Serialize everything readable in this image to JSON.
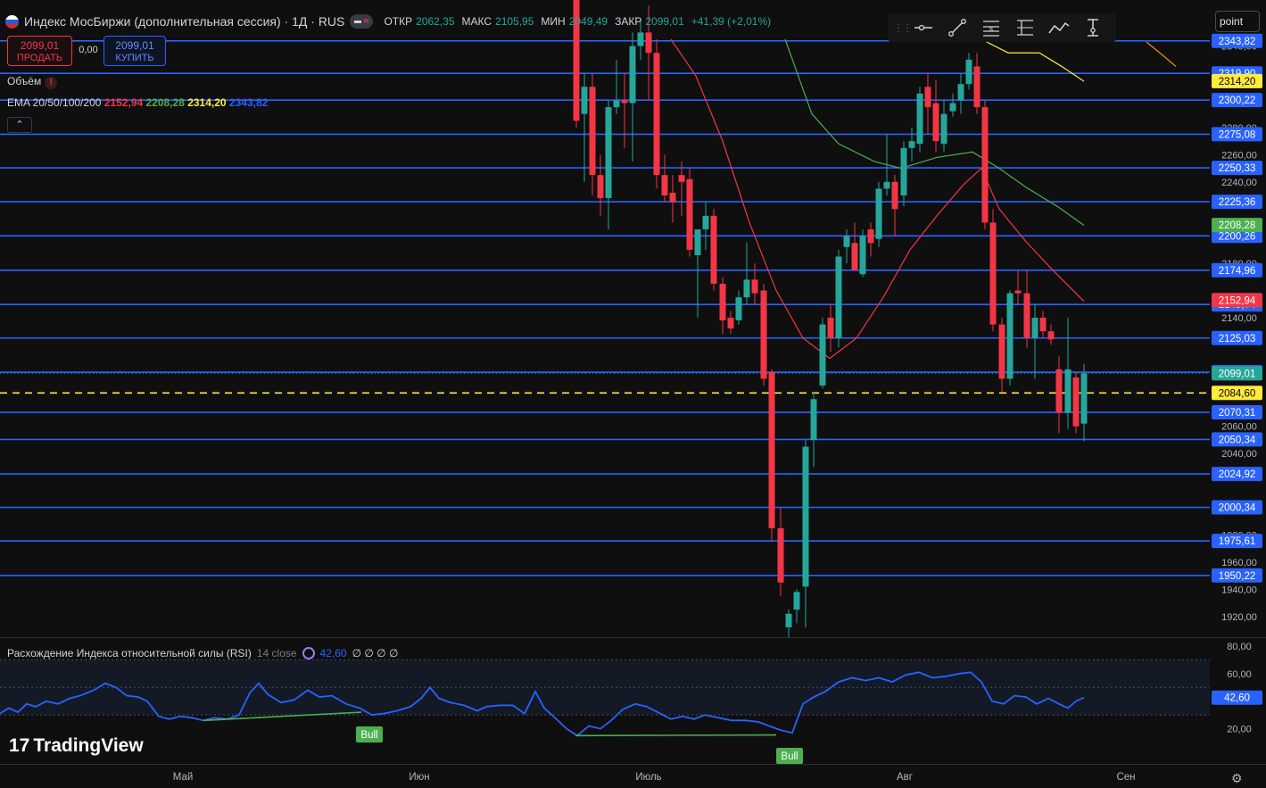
{
  "header": {
    "title": "Индекс МосБиржи (дополнительная сессия) · 1Д · RUS",
    "ohlc": [
      {
        "label": "ОТКР",
        "value": "2062,35"
      },
      {
        "label": "МАКС",
        "value": "2105,95"
      },
      {
        "label": "МИН",
        "value": "2049,49"
      },
      {
        "label": "ЗАКР",
        "value": "2099,01"
      },
      {
        "label": "",
        "value": "+41,39 (+2,01%)"
      }
    ]
  },
  "trade": {
    "sell_price": "2099,01",
    "sell_label": "ПРОДАТЬ",
    "spread": "0,00",
    "buy_price": "2099,01",
    "buy_label": "КУПИТЬ"
  },
  "legend": {
    "volume": "Объём",
    "ema_label": "EMA 20/50/100/200",
    "ema_values": [
      {
        "value": "2152,94",
        "color": "#f23645"
      },
      {
        "value": "2208,28",
        "color": "#4caf50"
      },
      {
        "value": "2314,20",
        "color": "#ffeb3b"
      },
      {
        "value": "2343,82",
        "color": "#2962ff"
      }
    ]
  },
  "collapse_icon": "chevron-up-icon",
  "toolbar_icons": [
    "horizontal-ray-icon",
    "trend-line-icon",
    "fib-retracement-icon",
    "price-range-icon",
    "path-icon",
    "measure-icon"
  ],
  "point_box": "point",
  "rsi": {
    "title": "Расхождение Индекса относительной силы (RSI)",
    "params": "14 close",
    "value": "42,60",
    "flags": "∅ ∅ ∅ ∅"
  },
  "brand": "TradingView",
  "colors": {
    "up": "#26a69a",
    "down": "#f23645",
    "level": "#2962ff",
    "current": "#ffeb3b",
    "rsi": "#2962ff",
    "bull": "#4caf50"
  },
  "chart_data": {
    "type": "candlestick",
    "ylim": [
      1910,
      2345
    ],
    "axis_ticks": [
      "1920,00",
      "1940,00",
      "1960,00",
      "1980,00",
      "2040,00",
      "2060,00",
      "2140,00",
      "2180,00",
      "2240,00",
      "2260,00",
      "2280,00",
      "2340,00"
    ],
    "x_labels": [
      {
        "label": "Май",
        "x": 205
      },
      {
        "label": "Июн",
        "x": 470
      },
      {
        "label": "Июль",
        "x": 727
      },
      {
        "label": "Авг",
        "x": 1014
      },
      {
        "label": "Сен",
        "x": 1262
      }
    ],
    "levels": [
      "2343,82",
      "2319,90",
      "2300,22",
      "2275,08",
      "2250,33",
      "2225,36",
      "2200,26",
      "2174,96",
      "2149,74",
      "2125,03",
      "2099,88",
      "2070,31",
      "2050,34",
      "2024,92",
      "2000,34",
      "1975,61",
      "1950,22"
    ],
    "current_price_line": "2084,60",
    "badges": [
      {
        "value": "2314,20",
        "color": "#ffeb3b"
      },
      {
        "value": "2208,28",
        "color": "#4caf50"
      },
      {
        "value": "2152,94",
        "color": "#f23645"
      },
      {
        "value": "2099,01",
        "color": "#26a69a"
      },
      {
        "value": "2084,60",
        "color": "#ffeb3b"
      }
    ],
    "candles": [
      {
        "x": 646,
        "o": 2400,
        "h": 2420,
        "l": 2280,
        "c": 2285
      },
      {
        "x": 655,
        "o": 2290,
        "h": 2320,
        "l": 2240,
        "c": 2310
      },
      {
        "x": 664,
        "o": 2310,
        "h": 2320,
        "l": 2230,
        "c": 2245
      },
      {
        "x": 673,
        "o": 2245,
        "h": 2260,
        "l": 2215,
        "c": 2228
      },
      {
        "x": 682,
        "o": 2228,
        "h": 2300,
        "l": 2205,
        "c": 2295
      },
      {
        "x": 691,
        "o": 2295,
        "h": 2330,
        "l": 2290,
        "c": 2300
      },
      {
        "x": 700,
        "o": 2300,
        "h": 2320,
        "l": 2265,
        "c": 2298
      },
      {
        "x": 709,
        "o": 2298,
        "h": 2350,
        "l": 2255,
        "c": 2340
      },
      {
        "x": 718,
        "o": 2340,
        "h": 2360,
        "l": 2330,
        "c": 2350
      },
      {
        "x": 727,
        "o": 2350,
        "h": 2370,
        "l": 2300,
        "c": 2335
      },
      {
        "x": 736,
        "o": 2335,
        "h": 2345,
        "l": 2235,
        "c": 2245
      },
      {
        "x": 745,
        "o": 2245,
        "h": 2260,
        "l": 2225,
        "c": 2230
      },
      {
        "x": 754,
        "o": 2232,
        "h": 2245,
        "l": 2210,
        "c": 2225
      },
      {
        "x": 764,
        "o": 2245,
        "h": 2255,
        "l": 2215,
        "c": 2240
      },
      {
        "x": 773,
        "o": 2242,
        "h": 2250,
        "l": 2185,
        "c": 2190
      },
      {
        "x": 782,
        "o": 2186,
        "h": 2205,
        "l": 2140,
        "c": 2205
      },
      {
        "x": 791,
        "o": 2205,
        "h": 2225,
        "l": 2190,
        "c": 2215
      },
      {
        "x": 800,
        "o": 2215,
        "h": 2220,
        "l": 2160,
        "c": 2165
      },
      {
        "x": 810,
        "o": 2165,
        "h": 2170,
        "l": 2128,
        "c": 2138
      },
      {
        "x": 819,
        "o": 2140,
        "h": 2145,
        "l": 2128,
        "c": 2132
      },
      {
        "x": 828,
        "o": 2138,
        "h": 2160,
        "l": 2135,
        "c": 2155
      },
      {
        "x": 837,
        "o": 2155,
        "h": 2195,
        "l": 2150,
        "c": 2168
      },
      {
        "x": 846,
        "o": 2168,
        "h": 2180,
        "l": 2150,
        "c": 2158
      },
      {
        "x": 856,
        "o": 2160,
        "h": 2165,
        "l": 2090,
        "c": 2095
      },
      {
        "x": 865,
        "o": 2100,
        "h": 2102,
        "l": 1975,
        "c": 1985
      },
      {
        "x": 875,
        "o": 1985,
        "h": 2000,
        "l": 1935,
        "c": 1945
      },
      {
        "x": 884,
        "o": 1912,
        "h": 1925,
        "l": 1895,
        "c": 1922
      },
      {
        "x": 893,
        "o": 1925,
        "h": 1940,
        "l": 1915,
        "c": 1938
      },
      {
        "x": 903,
        "o": 1942,
        "h": 2050,
        "l": 1912,
        "c": 2045
      },
      {
        "x": 912,
        "o": 2050,
        "h": 2085,
        "l": 2030,
        "c": 2080
      },
      {
        "x": 922,
        "o": 2090,
        "h": 2140,
        "l": 2088,
        "c": 2135
      },
      {
        "x": 931,
        "o": 2140,
        "h": 2150,
        "l": 2115,
        "c": 2125
      },
      {
        "x": 940,
        "o": 2125,
        "h": 2190,
        "l": 2118,
        "c": 2185
      },
      {
        "x": 949,
        "o": 2192,
        "h": 2205,
        "l": 2180,
        "c": 2200
      },
      {
        "x": 958,
        "o": 2195,
        "h": 2210,
        "l": 2175,
        "c": 2175
      },
      {
        "x": 967,
        "o": 2172,
        "h": 2205,
        "l": 2170,
        "c": 2200
      },
      {
        "x": 976,
        "o": 2205,
        "h": 2210,
        "l": 2185,
        "c": 2195
      },
      {
        "x": 985,
        "o": 2198,
        "h": 2240,
        "l": 2192,
        "c": 2235
      },
      {
        "x": 994,
        "o": 2235,
        "h": 2275,
        "l": 2230,
        "c": 2240
      },
      {
        "x": 1003,
        "o": 2240,
        "h": 2245,
        "l": 2200,
        "c": 2220
      },
      {
        "x": 1013,
        "o": 2230,
        "h": 2270,
        "l": 2222,
        "c": 2265
      },
      {
        "x": 1022,
        "o": 2265,
        "h": 2280,
        "l": 2255,
        "c": 2270
      },
      {
        "x": 1031,
        "o": 2268,
        "h": 2310,
        "l": 2262,
        "c": 2305
      },
      {
        "x": 1040,
        "o": 2310,
        "h": 2320,
        "l": 2275,
        "c": 2295
      },
      {
        "x": 1049,
        "o": 2298,
        "h": 2315,
        "l": 2262,
        "c": 2270
      },
      {
        "x": 1058,
        "o": 2268,
        "h": 2300,
        "l": 2262,
        "c": 2290
      },
      {
        "x": 1068,
        "o": 2292,
        "h": 2305,
        "l": 2288,
        "c": 2298
      },
      {
        "x": 1077,
        "o": 2300,
        "h": 2320,
        "l": 2290,
        "c": 2312
      },
      {
        "x": 1086,
        "o": 2312,
        "h": 2335,
        "l": 2308,
        "c": 2330
      },
      {
        "x": 1095,
        "o": 2325,
        "h": 2335,
        "l": 2290,
        "c": 2295
      },
      {
        "x": 1104,
        "o": 2295,
        "h": 2300,
        "l": 2205,
        "c": 2210
      },
      {
        "x": 1113,
        "o": 2210,
        "h": 2220,
        "l": 2130,
        "c": 2135
      },
      {
        "x": 1123,
        "o": 2135,
        "h": 2140,
        "l": 2085,
        "c": 2095
      },
      {
        "x": 1132,
        "o": 2095,
        "h": 2160,
        "l": 2090,
        "c": 2158
      },
      {
        "x": 1141,
        "o": 2160,
        "h": 2175,
        "l": 2150,
        "c": 2158
      },
      {
        "x": 1151,
        "o": 2158,
        "h": 2175,
        "l": 2118,
        "c": 2125
      },
      {
        "x": 1160,
        "o": 2125,
        "h": 2150,
        "l": 2095,
        "c": 2140
      },
      {
        "x": 1169,
        "o": 2140,
        "h": 2145,
        "l": 2125,
        "c": 2130
      },
      {
        "x": 1178,
        "o": 2130,
        "h": 2135,
        "l": 2120,
        "c": 2124
      },
      {
        "x": 1187,
        "o": 2102,
        "h": 2112,
        "l": 2055,
        "c": 2070
      },
      {
        "x": 1197,
        "o": 2070,
        "h": 2140,
        "l": 2058,
        "c": 2102
      },
      {
        "x": 1206,
        "o": 2096,
        "h": 2100,
        "l": 2055,
        "c": 2060
      },
      {
        "x": 1215,
        "o": 2062,
        "h": 2106,
        "l": 2049,
        "c": 2099
      }
    ],
    "ema_lines": [
      {
        "name": "EMA 20",
        "color": "#f23645",
        "points": [
          [
            752,
            2345
          ],
          [
            780,
            2318
          ],
          [
            810,
            2270
          ],
          [
            840,
            2210
          ],
          [
            870,
            2160
          ],
          [
            900,
            2125
          ],
          [
            930,
            2110
          ],
          [
            960,
            2125
          ],
          [
            990,
            2155
          ],
          [
            1020,
            2190
          ],
          [
            1050,
            2215
          ],
          [
            1080,
            2238
          ],
          [
            1100,
            2250
          ],
          [
            1120,
            2220
          ],
          [
            1150,
            2196
          ],
          [
            1180,
            2175
          ],
          [
            1215,
            2152
          ]
        ]
      },
      {
        "name": "EMA 50",
        "color": "#4caf50",
        "points": [
          [
            880,
            2345
          ],
          [
            910,
            2290
          ],
          [
            940,
            2268
          ],
          [
            980,
            2255
          ],
          [
            1010,
            2250
          ],
          [
            1050,
            2258
          ],
          [
            1090,
            2262
          ],
          [
            1120,
            2250
          ],
          [
            1150,
            2236
          ],
          [
            1185,
            2222
          ],
          [
            1215,
            2208
          ]
        ]
      },
      {
        "name": "EMA 100",
        "color": "#ffeb3b",
        "points": [
          [
            1100,
            2345
          ],
          [
            1130,
            2335
          ],
          [
            1165,
            2335
          ],
          [
            1190,
            2325
          ],
          [
            1215,
            2314
          ]
        ]
      },
      {
        "name": "EMA 200",
        "color": "#ff9800",
        "points": [
          [
            1285,
            2343
          ],
          [
            1300,
            2335
          ],
          [
            1318,
            2325
          ]
        ]
      }
    ],
    "rsi": {
      "ylim": [
        10,
        80
      ],
      "axis_ticks": [
        "80,00",
        "60,00",
        "20,00"
      ],
      "current": "42,60",
      "points": [
        [
          0,
          31
        ],
        [
          10,
          35
        ],
        [
          20,
          32
        ],
        [
          30,
          38
        ],
        [
          40,
          36
        ],
        [
          52,
          40
        ],
        [
          65,
          38
        ],
        [
          78,
          42
        ],
        [
          90,
          44
        ],
        [
          105,
          48
        ],
        [
          118,
          53
        ],
        [
          130,
          50
        ],
        [
          142,
          44
        ],
        [
          155,
          43
        ],
        [
          165,
          40
        ],
        [
          178,
          29
        ],
        [
          190,
          27
        ],
        [
          202,
          29
        ],
        [
          215,
          28
        ],
        [
          228,
          26
        ],
        [
          240,
          28
        ],
        [
          255,
          27
        ],
        [
          268,
          30
        ],
        [
          280,
          46
        ],
        [
          290,
          53
        ],
        [
          300,
          45
        ],
        [
          315,
          39
        ],
        [
          330,
          41
        ],
        [
          345,
          48
        ],
        [
          358,
          43
        ],
        [
          372,
          44
        ],
        [
          388,
          38
        ],
        [
          403,
          35
        ],
        [
          417,
          30
        ],
        [
          430,
          31
        ],
        [
          445,
          33
        ],
        [
          460,
          36
        ],
        [
          472,
          42
        ],
        [
          482,
          50
        ],
        [
          492,
          42
        ],
        [
          505,
          39
        ],
        [
          520,
          37
        ],
        [
          535,
          33
        ],
        [
          545,
          36
        ],
        [
          560,
          37
        ],
        [
          575,
          37
        ],
        [
          588,
          31
        ],
        [
          600,
          47
        ],
        [
          610,
          35
        ],
        [
          622,
          28
        ],
        [
          635,
          20
        ],
        [
          647,
          15
        ],
        [
          660,
          22
        ],
        [
          673,
          20
        ],
        [
          685,
          26
        ],
        [
          698,
          34
        ],
        [
          712,
          38
        ],
        [
          725,
          36
        ],
        [
          740,
          31
        ],
        [
          752,
          27
        ],
        [
          765,
          29
        ],
        [
          778,
          27
        ],
        [
          790,
          30
        ],
        [
          805,
          28
        ],
        [
          820,
          26
        ],
        [
          835,
          26
        ],
        [
          850,
          25
        ],
        [
          862,
          22
        ],
        [
          875,
          19
        ],
        [
          888,
          17
        ],
        [
          900,
          38
        ],
        [
          912,
          43
        ],
        [
          925,
          47
        ],
        [
          940,
          54
        ],
        [
          955,
          57
        ],
        [
          970,
          55
        ],
        [
          985,
          57
        ],
        [
          1000,
          54
        ],
        [
          1015,
          59
        ],
        [
          1030,
          61
        ],
        [
          1045,
          57
        ],
        [
          1060,
          58
        ],
        [
          1075,
          60
        ],
        [
          1088,
          61
        ],
        [
          1100,
          54
        ],
        [
          1112,
          40
        ],
        [
          1125,
          38
        ],
        [
          1137,
          44
        ],
        [
          1150,
          43
        ],
        [
          1162,
          38
        ],
        [
          1175,
          42
        ],
        [
          1187,
          38
        ],
        [
          1197,
          35
        ],
        [
          1206,
          40
        ],
        [
          1215,
          42.6
        ]
      ],
      "divergences": [
        {
          "from": [
            228,
            26
          ],
          "to": [
            405,
            32
          ],
          "label": "Bull",
          "label_x": 414,
          "label_y": 823
        },
        {
          "from": [
            645,
            15
          ],
          "to": [
            870,
            15.5
          ],
          "label": "Bull",
          "label_x": 885,
          "label_y": 847
        }
      ]
    }
  }
}
